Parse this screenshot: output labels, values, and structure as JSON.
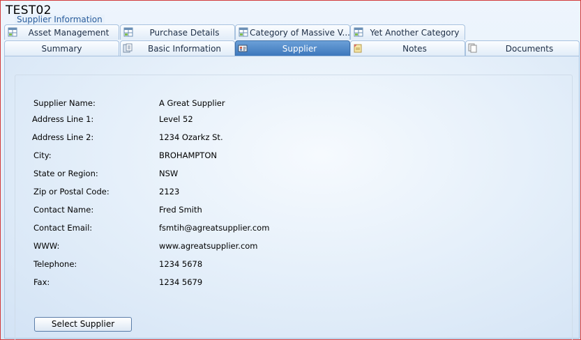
{
  "window": {
    "title": "TEST02"
  },
  "tabs_row1": [
    {
      "label": "Asset Management",
      "icon": "table-grid-icon"
    },
    {
      "label": "Purchase Details",
      "icon": "table-grid-icon"
    },
    {
      "label": "Category of Massive V...",
      "icon": "table-grid-icon"
    },
    {
      "label": "Yet Another Category",
      "icon": "table-grid-icon"
    }
  ],
  "tabs_row2": [
    {
      "label": "Summary"
    },
    {
      "label": "Basic Information",
      "icon": "info-card-icon"
    },
    {
      "label": "Supplier",
      "icon": "supplier-card-icon",
      "active": true
    },
    {
      "label": "Notes",
      "icon": "note-icon"
    },
    {
      "label": "Documents",
      "icon": "documents-icon"
    }
  ],
  "section": {
    "legend": "Supplier Information"
  },
  "fields": [
    {
      "label": "Supplier Name:",
      "value": "A Great Supplier"
    },
    {
      "label": "Address Line 1:",
      "value": "Level 52"
    },
    {
      "label": "Address Line 2:",
      "value": "1234 Ozarkz St."
    },
    {
      "label": "City:",
      "value": "BROHAMPTON"
    },
    {
      "label": "State or Region:",
      "value": "NSW"
    },
    {
      "label": "Zip or Postal Code:",
      "value": "2123"
    },
    {
      "label": "Contact Name:",
      "value": "Fred Smith"
    },
    {
      "label": "Contact Email:",
      "value": "fsmtih@agreatsupplier.com"
    },
    {
      "label": "WWW:",
      "value": "www.agreatsupplier.com"
    },
    {
      "label": "Telephone:",
      "value": "1234 5678"
    },
    {
      "label": "Fax:",
      "value": "1234 5679"
    }
  ],
  "buttons": {
    "select_supplier": "Select Supplier"
  },
  "colors": {
    "active_tab": "#3d77bc",
    "legend_text": "#2a5d9c",
    "frame_border": "#d23a3a"
  }
}
